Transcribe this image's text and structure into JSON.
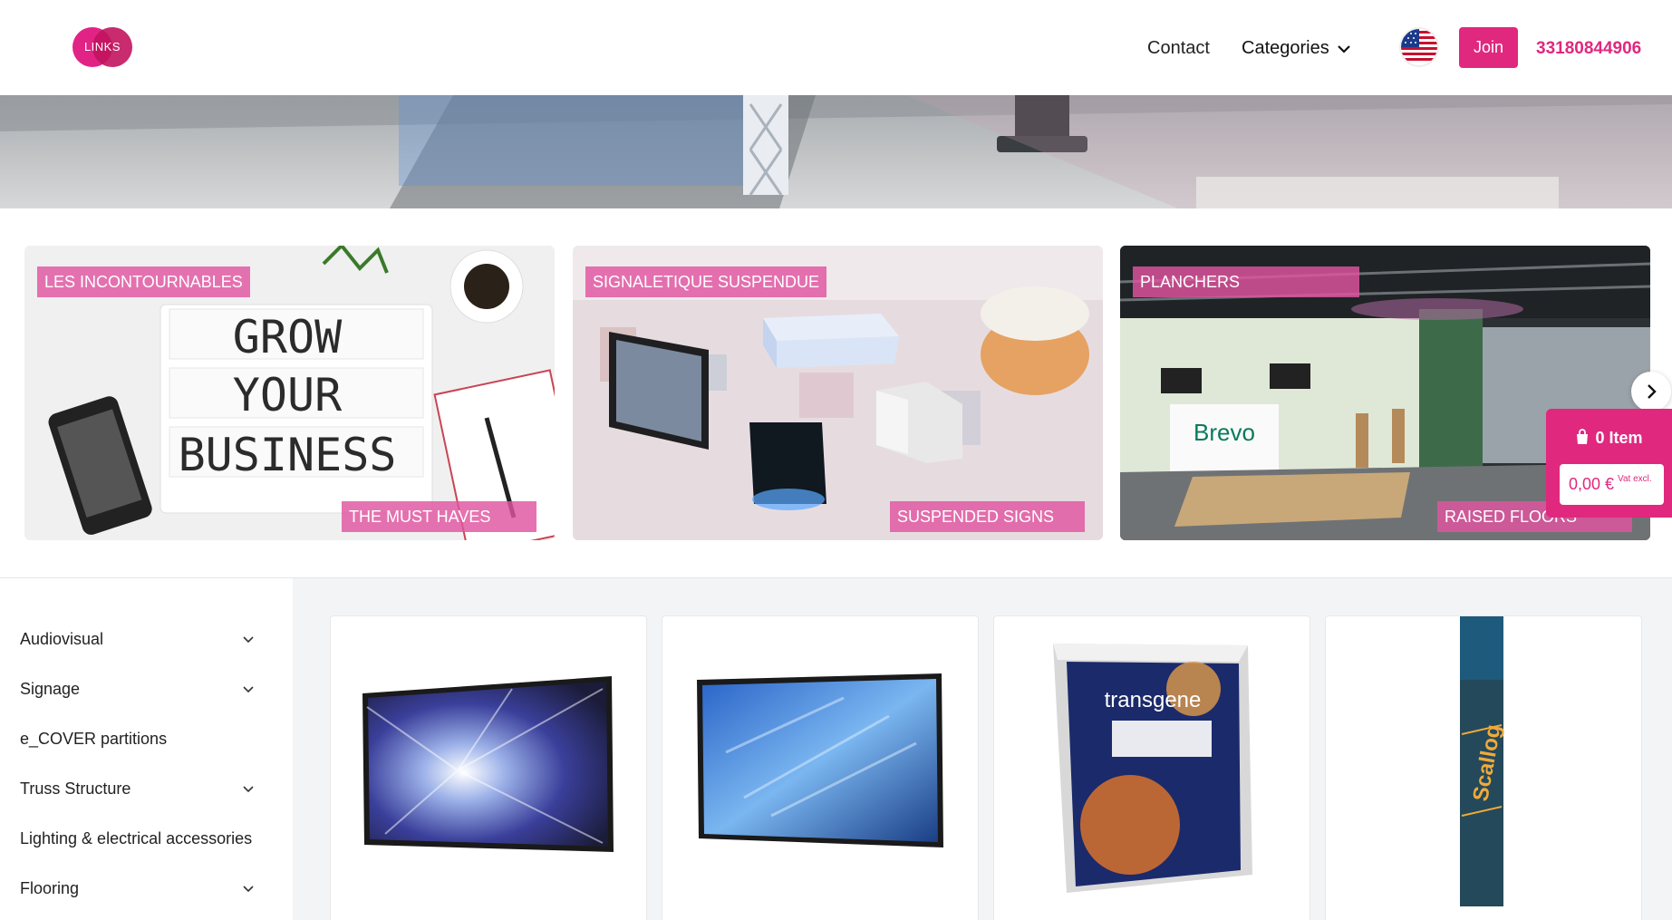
{
  "header": {
    "logo_text": "LINKS",
    "nav": {
      "contact": "Contact",
      "categories": "Categories"
    },
    "language_flag": "us-flag-icon",
    "join_label": "Join",
    "phone": "33180844906"
  },
  "category_cards": [
    {
      "tag_top": "LES INCONTOURNABLES",
      "tag_bottom": "THE MUST HAVES",
      "image_text": [
        "GROW",
        "YOUR",
        "BUSINESS"
      ]
    },
    {
      "tag_top": "SIGNALETIQUE SUSPENDUE",
      "tag_bottom": "SUSPENDED SIGNS"
    },
    {
      "tag_top": "PLANCHERS",
      "tag_bottom": "RAISED FLOORS",
      "image_text": [
        "Brevo"
      ]
    }
  ],
  "cart": {
    "items_label": "0 Item",
    "price": "0,00 €",
    "vat_note": "Vat excl."
  },
  "sidebar": {
    "items": [
      {
        "label": "Audiovisual",
        "has_dropdown": true
      },
      {
        "label": "Signage",
        "has_dropdown": true
      },
      {
        "label": "e_COVER partitions",
        "has_dropdown": false
      },
      {
        "label": "Truss Structure",
        "has_dropdown": true
      },
      {
        "label": "Lighting & electrical accessories",
        "has_dropdown": false
      },
      {
        "label": "Flooring",
        "has_dropdown": true
      }
    ]
  },
  "products": [
    {
      "image": "tv-screen"
    },
    {
      "image": "tv-screen"
    },
    {
      "image": "counter-print",
      "image_text": "transgene"
    },
    {
      "image": "totem-banner",
      "image_text": "Scallog"
    }
  ],
  "colors": {
    "accent": "#e0287f",
    "tag_pink": "#e054a0"
  }
}
